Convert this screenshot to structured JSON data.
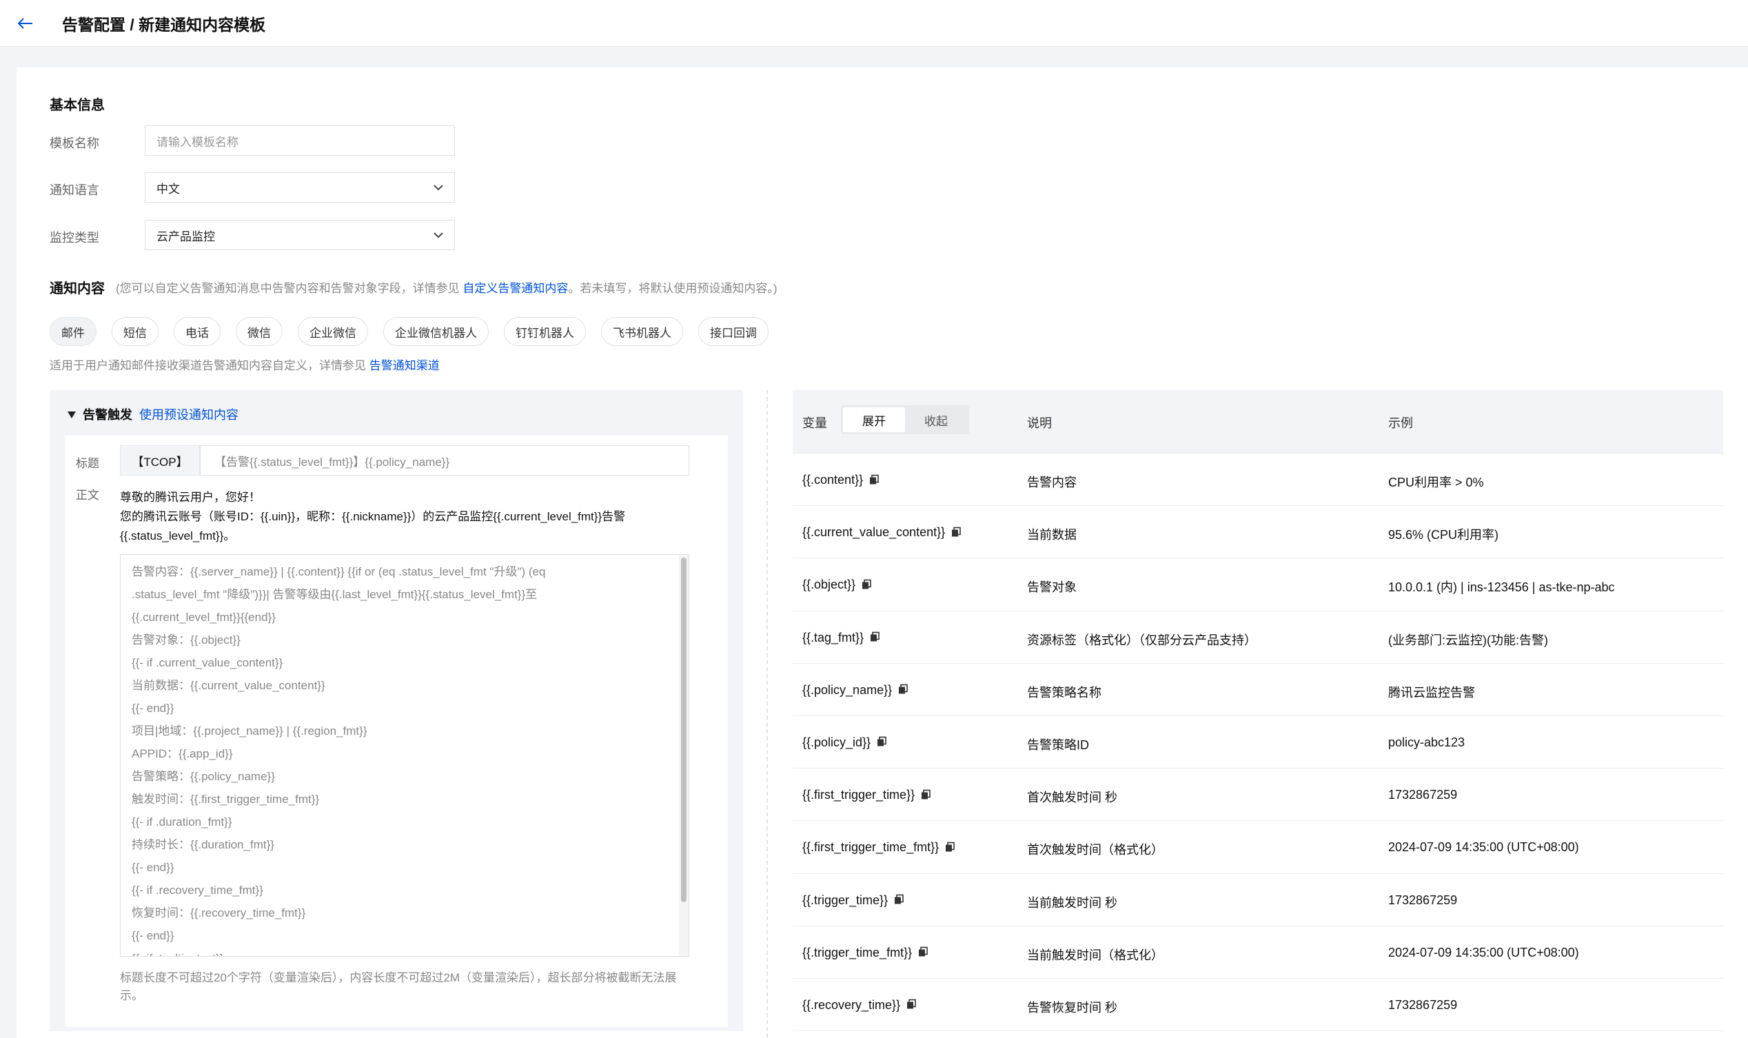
{
  "header": {
    "title": "告警配置 / 新建通知内容模板"
  },
  "basic": {
    "section_title": "基本信息",
    "name_label": "模板名称",
    "name_placeholder": "请输入模板名称",
    "lang_label": "通知语言",
    "lang_value": "中文",
    "type_label": "监控类型",
    "type_value": "云产品监控"
  },
  "notify": {
    "section_title": "通知内容",
    "desc_prefix": "(您可以自定义告警通知消息中告警内容和告警对象字段，详情参见 ",
    "desc_link": "自定义告警通知内容",
    "desc_suffix": "。若未填写，将默认使用预设通知内容。)",
    "tabs": [
      "邮件",
      "短信",
      "电话",
      "微信",
      "企业微信",
      "企业微信机器人",
      "钉钉机器人",
      "飞书机器人",
      "接口回调"
    ],
    "hint_prefix": "适用于用户通知邮件接收渠道告警通知内容自定义，详情参见 ",
    "hint_link": "告警通知渠道"
  },
  "editor": {
    "panel_title": "告警触发",
    "use_preset_link": "使用预设通知内容",
    "title_label": "标题",
    "title_prefix": "【TCOP】",
    "title_value": "【告警{{.status_level_fmt}}】{{.policy_name}}",
    "body_label": "正文",
    "body_static_1": "尊敬的腾讯云用户，您好！",
    "body_static_2": "您的腾讯云账号（账号ID：{{.uin}}，昵称：{{.nickname}}）的云产品监控{{.current_level_fmt}}告警{{.status_level_fmt}}。",
    "lines": [
      "告警内容：{{.server_name}} | {{.content}} {{if or (eq .status_level_fmt \"升级\") (eq",
      ".status_level_fmt \"降级\")}}| 告警等级由{{.last_level_fmt}}{{.status_level_fmt}}至",
      "{{.current_level_fmt}}{{end}}",
      "告警对象：{{.object}}",
      "{{- if .current_value_content}}",
      "当前数据：{{.current_value_content}}",
      "{{- end}}",
      "项目|地域：{{.project_name}} | {{.region_fmt}}",
      "APPID：{{.app_id}}",
      "告警策略：{{.policy_name}}",
      "触发时间：{{.first_trigger_time_fmt}}",
      "{{- if .duration_fmt}}",
      "持续时长：{{.duration_fmt}}",
      "{{- end}}",
      "{{- if .recovery_time_fmt}}",
      "恢复时间：{{.recovery_time_fmt}}",
      "{{- end}}",
      "{{- if .tooltip_text}}"
    ],
    "footer": "标题长度不可超过20个字符（变量渲染后），内容长度不可超过2M（变量渲染后），超长部分将被截断无法展示。"
  },
  "variables": {
    "col_var": "变量",
    "expand": "展开",
    "collapse": "收起",
    "col_desc": "说明",
    "col_example": "示例",
    "rows": [
      {
        "name": "{{.content}}",
        "desc": "告警内容",
        "example": "CPU利用率 > 0%"
      },
      {
        "name": "{{.current_value_content}}",
        "desc": "当前数据",
        "example": "95.6% (CPU利用率)"
      },
      {
        "name": "{{.object}}",
        "desc": "告警对象",
        "example": "10.0.0.1 (内) | ins-123456 | as-tke-np-abc"
      },
      {
        "name": "{{.tag_fmt}}",
        "desc": "资源标签（格式化）（仅部分云产品支持）",
        "example": "(业务部门:云监控)(功能:告警)"
      },
      {
        "name": "{{.policy_name}}",
        "desc": "告警策略名称",
        "example": "腾讯云监控告警"
      },
      {
        "name": "{{.policy_id}}",
        "desc": "告警策略ID",
        "example": "policy-abc123"
      },
      {
        "name": "{{.first_trigger_time}}",
        "desc": "首次触发时间 秒",
        "example": "1732867259"
      },
      {
        "name": "{{.first_trigger_time_fmt}}",
        "desc": "首次触发时间（格式化）",
        "example": "2024-07-09 14:35:00 (UTC+08:00)"
      },
      {
        "name": "{{.trigger_time}}",
        "desc": "当前触发时间 秒",
        "example": "1732867259"
      },
      {
        "name": "{{.trigger_time_fmt}}",
        "desc": "当前触发时间（格式化）",
        "example": "2024-07-09 14:35:00 (UTC+08:00)"
      },
      {
        "name": "{{.recovery_time}}",
        "desc": "告警恢复时间 秒",
        "example": "1732867259"
      }
    ]
  }
}
